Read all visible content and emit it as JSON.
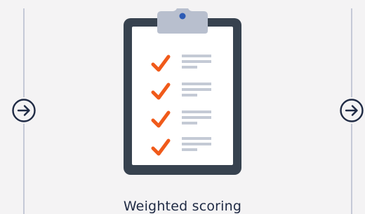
{
  "card": {
    "caption": "Weighted scoring",
    "icon": "clipboard-checklist-icon",
    "checklist_items": 4
  },
  "navigation": {
    "previous_icon": "arrow-right-circle-icon",
    "next_icon": "arrow-right-circle-icon"
  },
  "colors": {
    "background": "#f4f3f4",
    "divider": "#c5c9d7",
    "clipboard_frame": "#37424f",
    "clipboard_paper": "#ffffff",
    "clip": "#b8bfce",
    "clip_dot": "#2d5bb5",
    "check": "#f05a1a",
    "text_lines": "#c4cad5",
    "caption": "#1f2a44",
    "arrow": "#1f2a44"
  }
}
